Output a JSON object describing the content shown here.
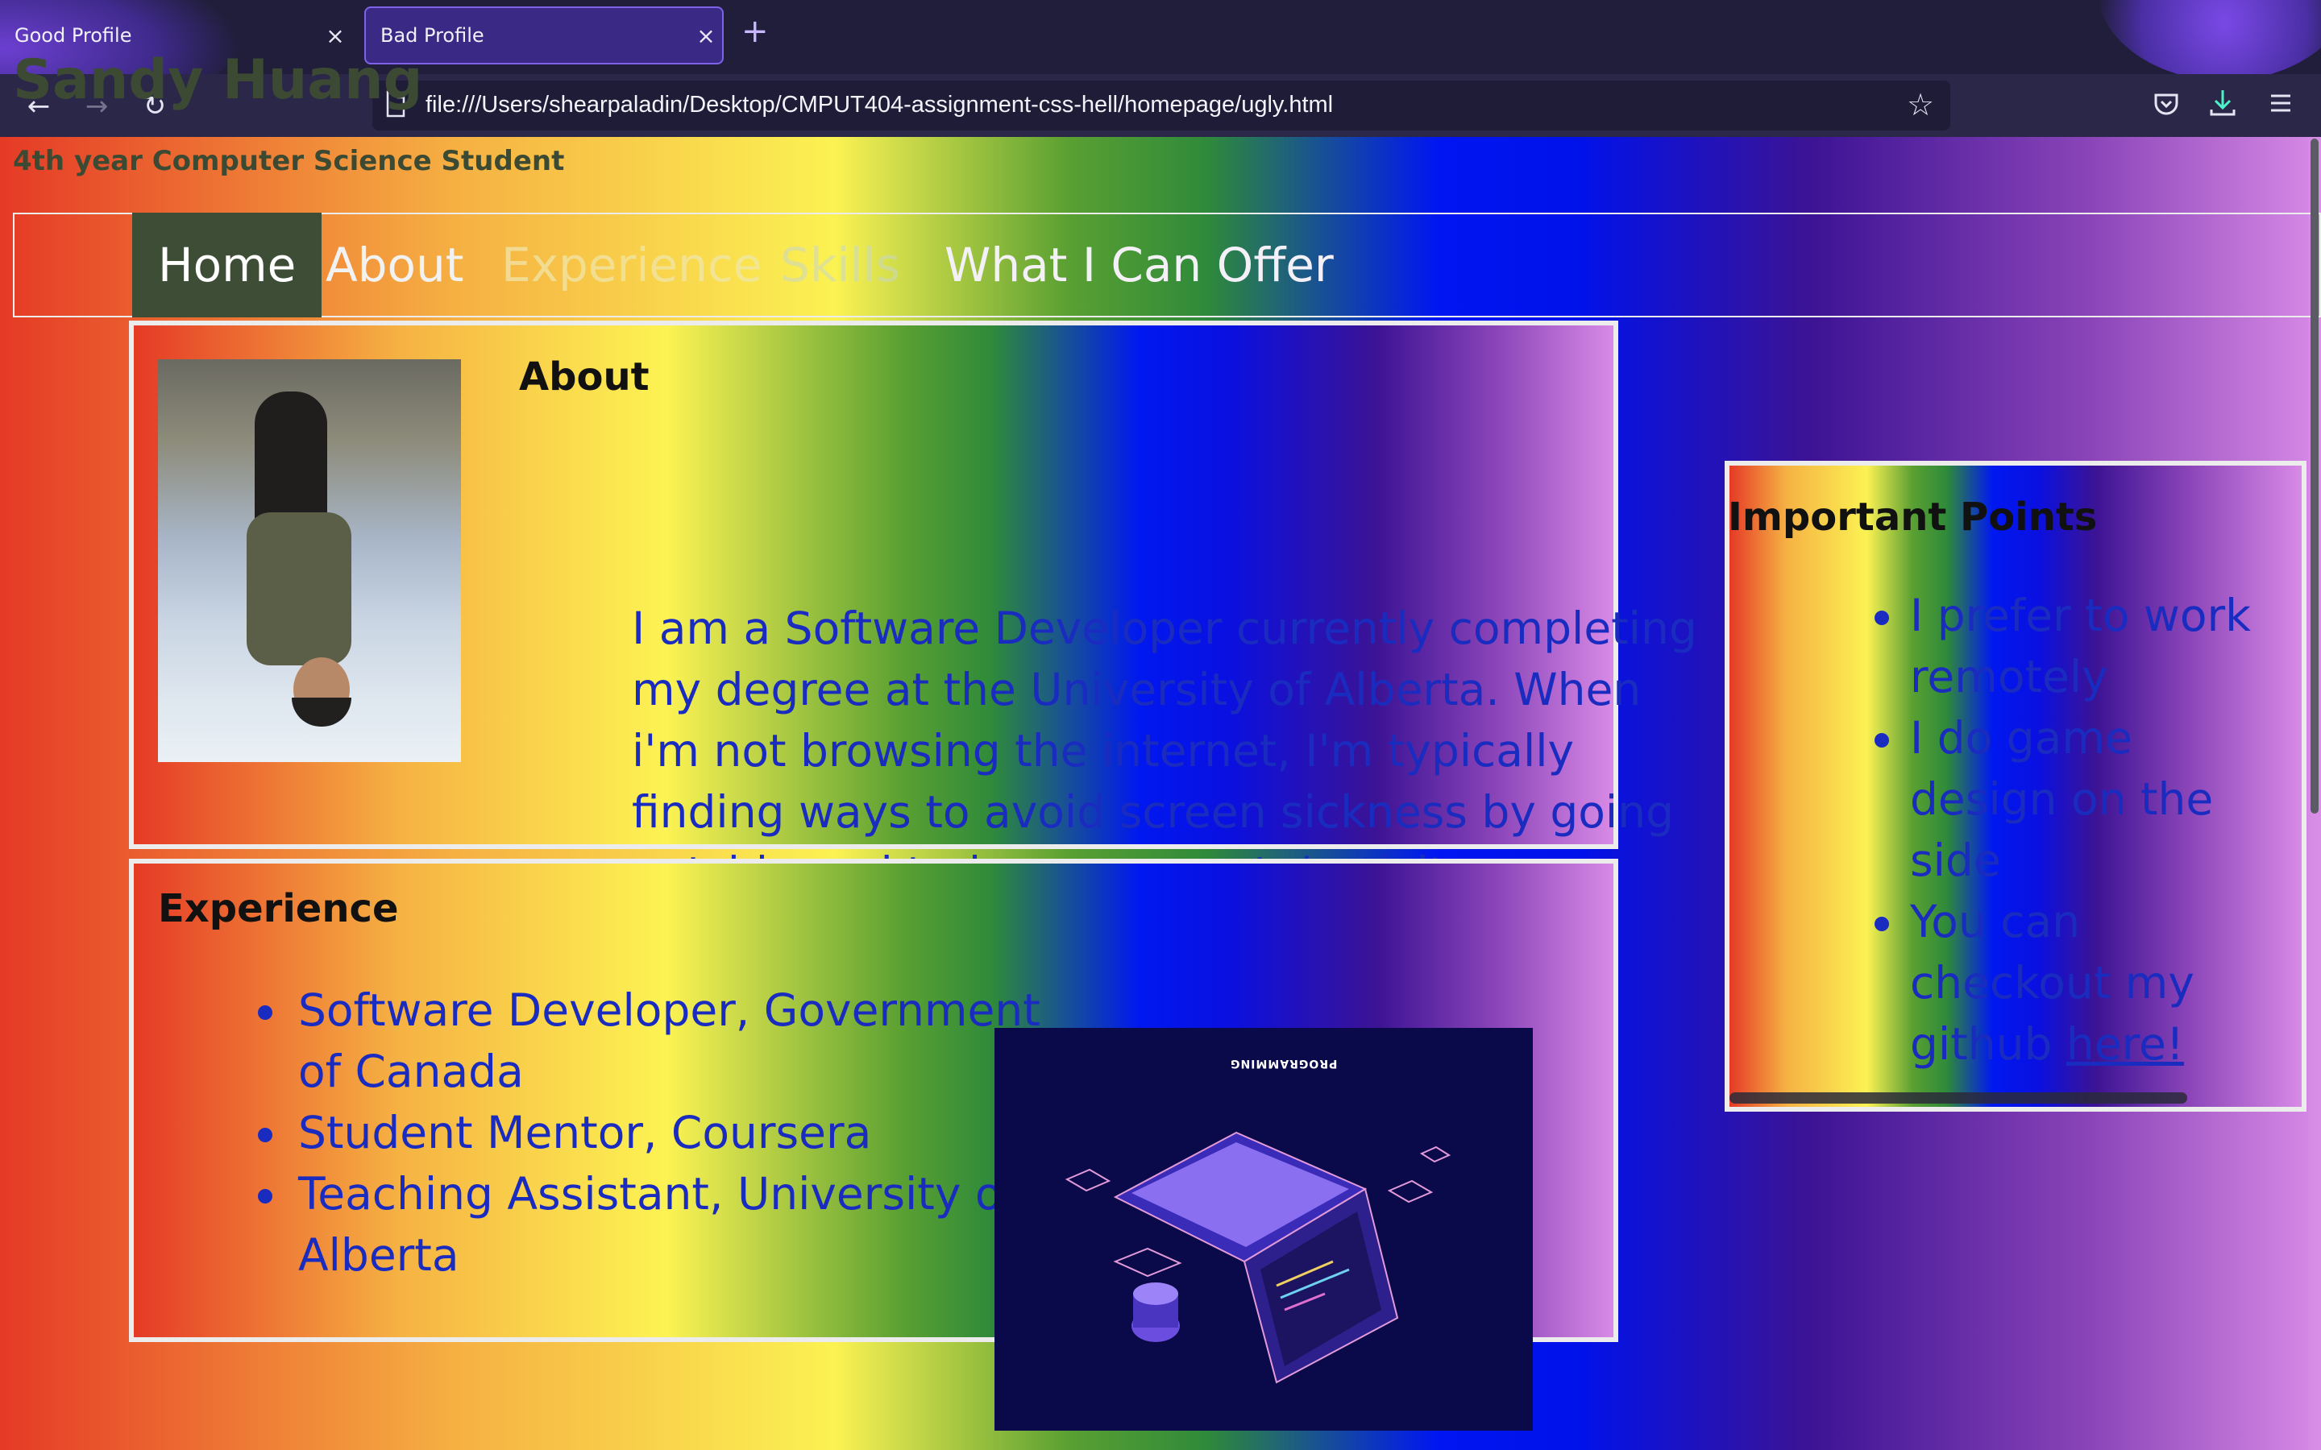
{
  "browser": {
    "tabs": [
      {
        "title": "Good Profile",
        "active": false
      },
      {
        "title": "Bad Profile",
        "active": true
      }
    ],
    "new_tab_symbol": "+",
    "close_symbol": "×",
    "url": "file:///Users/shearpaladin/Desktop/CMPUT404-assignment-css-hell/homepage/ugly.html",
    "icons": {
      "back": "arrow-left-icon",
      "forward": "arrow-right-icon",
      "reload": "reload-icon",
      "page": "page-icon",
      "bookmark": "star-icon",
      "pocket": "pocket-icon",
      "downloads": "download-icon",
      "menu": "hamburger-menu-icon"
    },
    "colors": {
      "tabbar": "#201e3a",
      "active_tab": "#3a2a86",
      "active_tab_border": "#7e62e8",
      "toolbar": "#2a2749"
    }
  },
  "page": {
    "title": "Sandy Huang",
    "subtitle": "4th year Computer Science Student",
    "nav": [
      "Home",
      "About",
      "Experience",
      "Skills",
      "What I Can Offer"
    ],
    "about": {
      "heading": "About",
      "text": "I am a Software Developer currently completing my degree at the University of Alberta. When i'm not browsing the internet, I'm typically finding ways to avoid screen sickness by going outside and trying new sports/activites."
    },
    "experience": {
      "heading": "Experience",
      "items": [
        "Software Developer, Government of Canada",
        "Student Mentor, Coursera",
        "Teaching Assistant, University of Alberta"
      ],
      "image_caption": "PROGRAMMING"
    },
    "important_points": {
      "heading": "Important Points",
      "items": [
        "I prefer to work remotely",
        "I do game design on the side"
      ],
      "github_prefix": "You can checkout my github ",
      "github_link": "here!"
    },
    "colors": {
      "heading_text": "#3c4a33",
      "body_text": "#1a2bc0",
      "nav_home_bg": "#3d4d36",
      "rainbow": [
        "#e53a26",
        "#f6b243",
        "#fbf253",
        "#2f8a3a",
        "#0015f2",
        "#3c1394",
        "#d88ae6"
      ]
    }
  }
}
